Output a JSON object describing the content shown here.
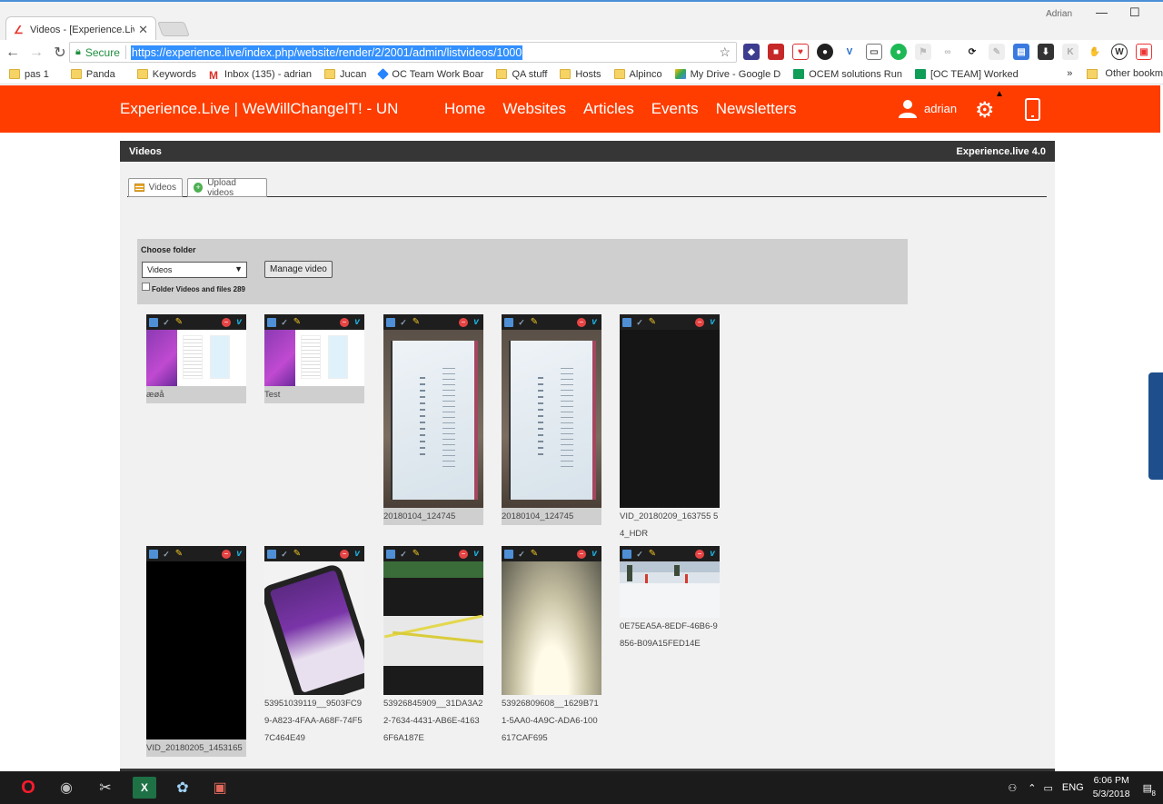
{
  "browser": {
    "tab_title": "Videos - [Experience.Live",
    "user_label": "Adrian",
    "secure_label": "Secure",
    "url": "https://experience.live/index.php/website/render/2/2001/admin/listvideos/1000",
    "bookmarks": [
      "pas 1",
      "Panda",
      "Keywords",
      "Inbox (135) - adrian",
      "Jucan",
      "OC Team Work Boar",
      "QA stuff",
      "Hosts",
      "Alpinco",
      "My Drive - Google D",
      "OCEM solutions Run",
      "[OC TEAM] Worked"
    ],
    "bookmarks_more": "»",
    "bookmarks_other": "Other bookm"
  },
  "site": {
    "brand": "Experience.Live | WeWillChangeIT! - UN",
    "nav": [
      "Home",
      "Websites",
      "Articles",
      "Events",
      "Newsletters"
    ],
    "username": "adrian",
    "accent_color": "#ff3d00"
  },
  "panel": {
    "title": "Videos",
    "version": "Experience.live 4.0",
    "tab_videos": "Videos",
    "tab_upload": "Upload videos",
    "choose_folder_label": "Choose folder",
    "folder_selected": "Videos",
    "manage_button": "Manage video",
    "folder_summary": "Folder Videos and files 289"
  },
  "videos": [
    {
      "caption": "æøå",
      "kind": "screen"
    },
    {
      "caption": "Test",
      "kind": "screen"
    },
    {
      "caption": "20180104_124745",
      "kind": "monitor"
    },
    {
      "caption": "20180104_124745",
      "kind": "monitor"
    },
    {
      "caption": "VID_20180209_163755 54_HDR",
      "kind": "dark"
    },
    {
      "caption": "VID_20180205_1453165",
      "kind": "black"
    },
    {
      "caption": "53951039119__9503FC9 9-A823-4FAA-A68F-74F5 7C464E49",
      "kind": "phone"
    },
    {
      "caption": "53926845909__31DA3A2 2-7634-4431-AB6E-4163 6F6A187E",
      "kind": "cables"
    },
    {
      "caption": "53926809608__1629B71 1-5AA0-4A9C-ADA6-100 617CAF695",
      "kind": "light"
    },
    {
      "caption": "0E75EA5A-8EDF-46B6-9 856-B09A15FED14E",
      "kind": "snow"
    }
  ],
  "taskbar": {
    "lang": "ENG",
    "time": "6:06 PM",
    "date": "5/3/2018",
    "notifications": "8"
  }
}
